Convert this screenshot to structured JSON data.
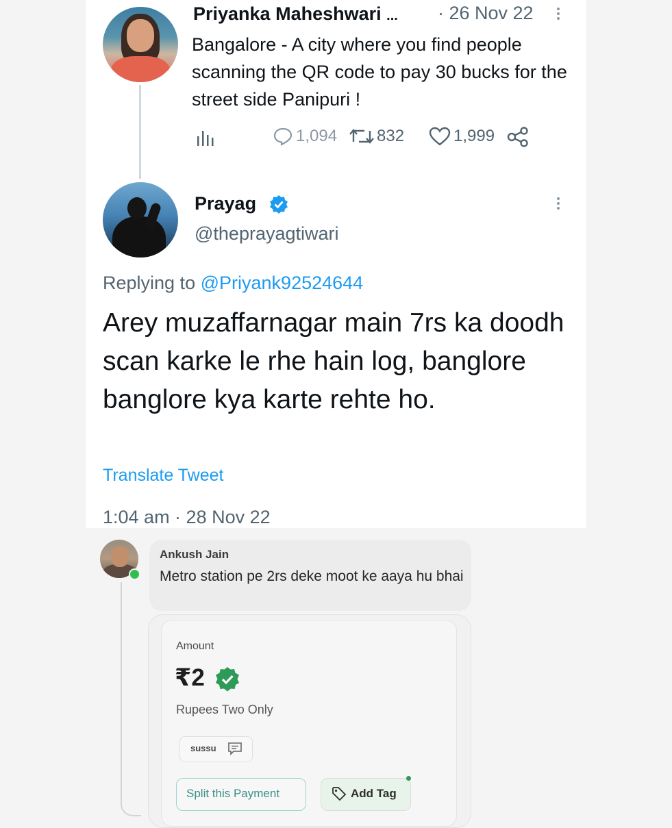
{
  "tweet1": {
    "author_name": "Priyanka Maheshwari",
    "ellipsis": "...",
    "date": "· 26 Nov 22",
    "text": "Bangalore - A city where you find people scanning the QR code to pay 30 bucks for the street side Panipuri !",
    "replies": "1,094",
    "retweets": "832",
    "likes": "1,999"
  },
  "tweet2": {
    "author_name": "Prayag",
    "handle": "@theprayagtiwari",
    "replying_prefix": "Replying to",
    "replying_mention": "@Priyank92524644",
    "text": "Arey muzaffarnagar main 7rs ka doodh scan karke le rhe hain log, banglore banglore kya karte rehte ho.",
    "translate_link": "Translate Tweet",
    "timestamp": "1:04 am · 28 Nov 22"
  },
  "payment_chat": {
    "sender": "Ankush Jain",
    "message": "Metro station pe 2rs deke moot ke aaya hu bhai",
    "amount_label": "Amount",
    "amount_value": "₹2",
    "amount_words": "Rupees Two Only",
    "note": "sussu",
    "split_button": "Split this Payment",
    "tag_button": "Add Tag"
  },
  "colors": {
    "twitter_blue": "#1d9bf0",
    "muted_text": "#536471",
    "verified_green": "#2e9a58",
    "online_green": "#2fbf4f"
  }
}
